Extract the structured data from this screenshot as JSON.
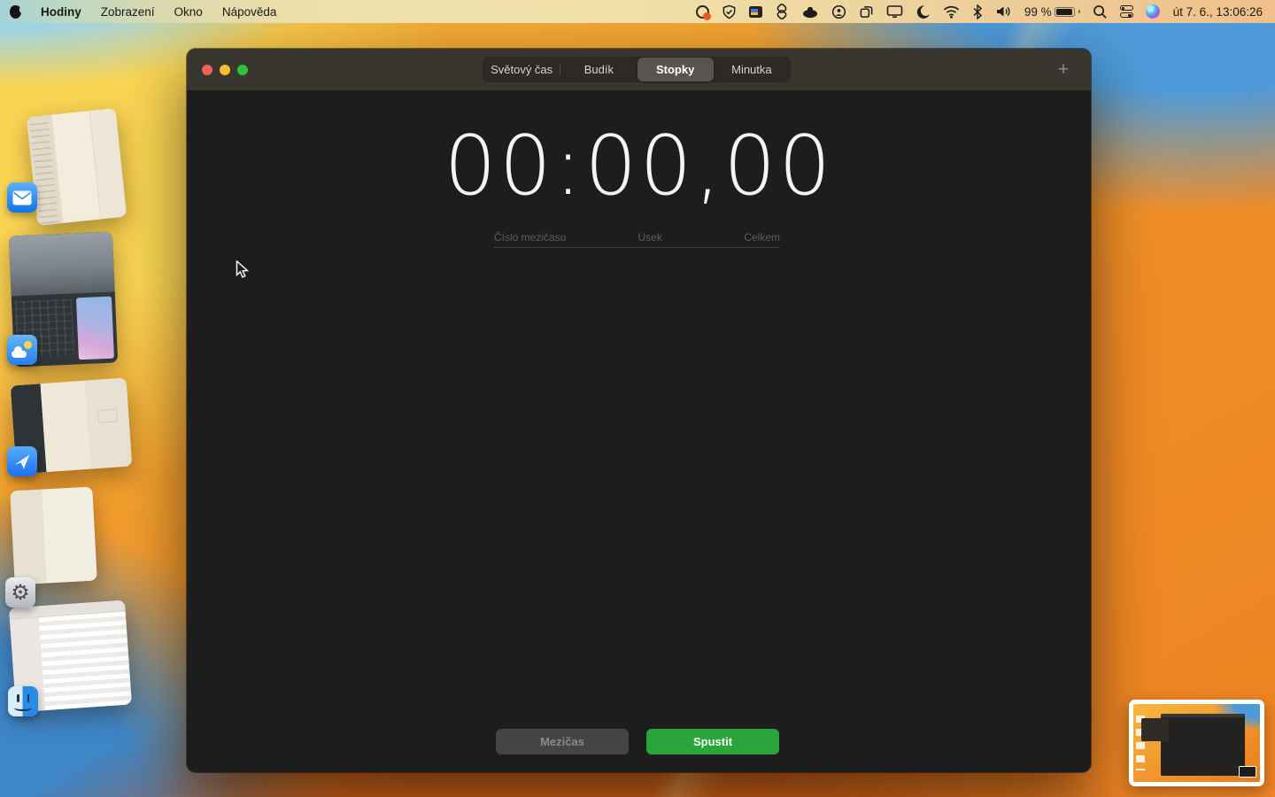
{
  "menubar": {
    "app_name": "Hodiny",
    "menus": [
      "Zobrazení",
      "Okno",
      "Nápověda"
    ],
    "battery_percent": "99 %",
    "clock": "út 7. 6., 13:06:26",
    "status_icons": [
      "app-swirl-icon",
      "shield-check-icon",
      "flag-icon",
      "layers-icon",
      "hat-icon",
      "account-icon",
      "copy-icon",
      "display-icon",
      "moon-icon",
      "wifi-icon",
      "bluetooth-icon",
      "volume-icon",
      "battery-icon",
      "spotlight-icon",
      "control-center-icon",
      "siri-icon"
    ]
  },
  "window": {
    "tabs": [
      "Světový čas",
      "Budík",
      "Stopky",
      "Minutka"
    ],
    "active_tab": "Stopky",
    "add_label": "+",
    "stopwatch": {
      "time": "00:00,00",
      "columns": [
        "Číslo mezičasu",
        "Úsek",
        "Celkem"
      ],
      "lap_label": "Mezičas",
      "start_label": "Spustit"
    }
  },
  "expose_apps": [
    "mail-icon",
    "weather-icon",
    "spark-icon",
    "settings-icon",
    "finder-icon"
  ],
  "colors": {
    "start_button_green": "#2aa53c",
    "window_bg": "#1d1d1d",
    "titlebar_bg": "#39352f",
    "traffic_red": "#f2605a",
    "traffic_yellow": "#f5bd2e",
    "traffic_green": "#2ec23e"
  }
}
